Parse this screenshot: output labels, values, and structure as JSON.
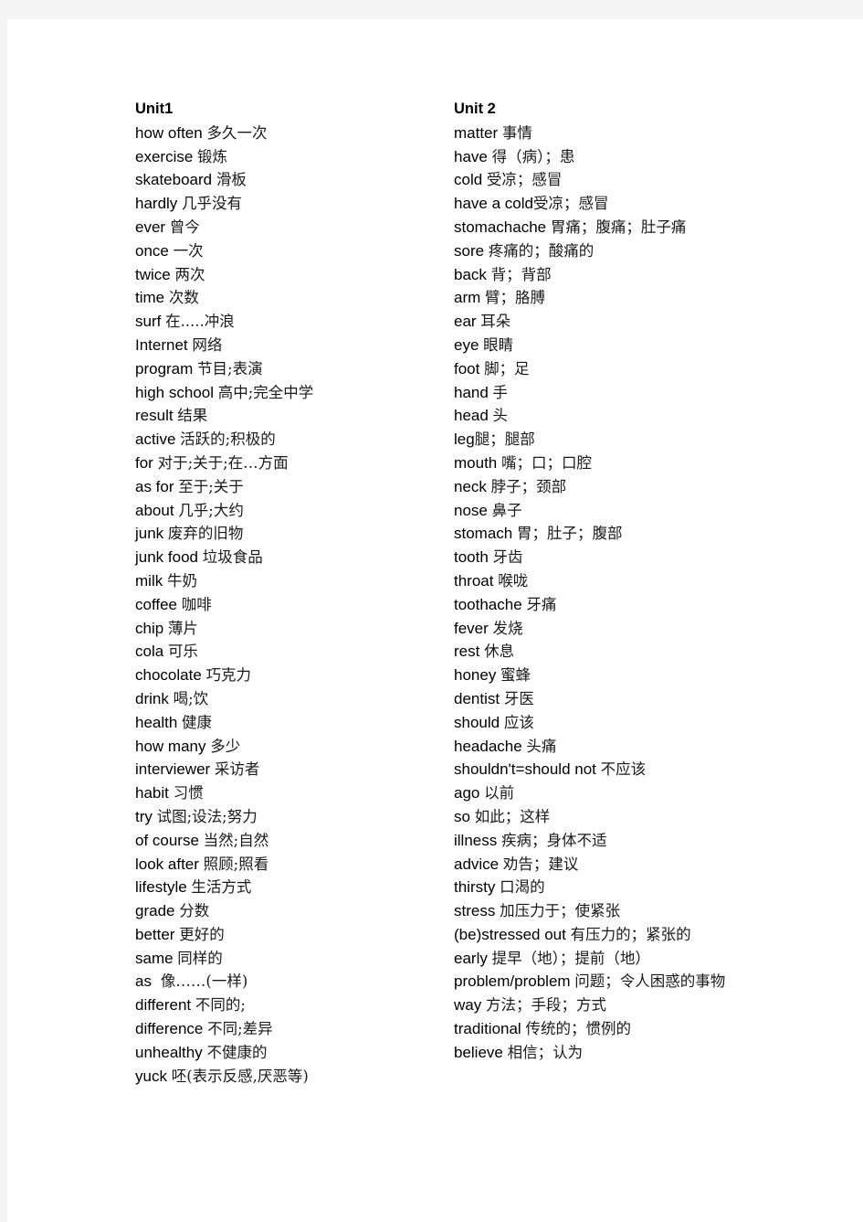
{
  "page": {
    "background_color": "#ffffff",
    "margin_color": "#f4f4f4",
    "text_color": "#000000"
  },
  "columns": [
    {
      "id": "unit1",
      "title": "Unit1",
      "entries": [
        {
          "en": "how often ",
          "cn": "多久一次"
        },
        {
          "en": "exercise ",
          "cn": "锻炼"
        },
        {
          "en": "skateboard ",
          "cn": "滑板"
        },
        {
          "en": "hardly ",
          "cn": "几乎没有"
        },
        {
          "en": "ever ",
          "cn": "曾今"
        },
        {
          "en": "once ",
          "cn": "一次"
        },
        {
          "en": "twice ",
          "cn": "两次"
        },
        {
          "en": "time ",
          "cn": "次数"
        },
        {
          "en": "surf ",
          "cn": "在.....冲浪"
        },
        {
          "en": "Internet ",
          "cn": "网络"
        },
        {
          "en": "program ",
          "cn": "节目;表演"
        },
        {
          "en": "high school ",
          "cn": "高中;完全中学"
        },
        {
          "en": "result ",
          "cn": "结果"
        },
        {
          "en": "active ",
          "cn": "活跃的;积极的"
        },
        {
          "en": "for ",
          "cn": "对于;关于;在…方面"
        },
        {
          "en": "as for ",
          "cn": "至于;关于"
        },
        {
          "en": "about ",
          "cn": "几乎;大约"
        },
        {
          "en": "junk ",
          "cn": "废弃的旧物"
        },
        {
          "en": "junk food ",
          "cn": "垃圾食品"
        },
        {
          "en": "milk ",
          "cn": "牛奶"
        },
        {
          "en": "coffee ",
          "cn": "咖啡"
        },
        {
          "en": "chip ",
          "cn": "薄片"
        },
        {
          "en": "cola ",
          "cn": "可乐"
        },
        {
          "en": "chocolate ",
          "cn": "巧克力"
        },
        {
          "en": "drink ",
          "cn": "喝;饮"
        },
        {
          "en": "health ",
          "cn": "健康"
        },
        {
          "en": "how many ",
          "cn": "多少"
        },
        {
          "en": "interviewer ",
          "cn": "采访者"
        },
        {
          "en": "habit ",
          "cn": "习惯"
        },
        {
          "en": "try ",
          "cn": "试图;设法;努力"
        },
        {
          "en": "of course ",
          "cn": "当然;自然"
        },
        {
          "en": "look after ",
          "cn": "照顾;照看"
        },
        {
          "en": "lifestyle ",
          "cn": "生活方式"
        },
        {
          "en": "grade ",
          "cn": "分数"
        },
        {
          "en": "better ",
          "cn": "更好的"
        },
        {
          "en": "same ",
          "cn": "同样的"
        },
        {
          "en": "as ",
          "cn": "  像……(一样)"
        },
        {
          "en": "different ",
          "cn": "不同的;"
        },
        {
          "en": "difference ",
          "cn": "不同;差异"
        },
        {
          "en": "unhealthy ",
          "cn": "不健康的"
        },
        {
          "en": "yuck ",
          "cn": "呸(表示反感,厌恶等)"
        }
      ]
    },
    {
      "id": "unit2",
      "title": "Unit 2",
      "entries": [
        {
          "en": "matter ",
          "cn": "事情"
        },
        {
          "en": "have ",
          "cn": "得（病）；患"
        },
        {
          "en": "cold ",
          "cn": "受凉；感冒"
        },
        {
          "en": "have a cold",
          "cn": "受凉；感冒"
        },
        {
          "en": "stomachache ",
          "cn": "胃痛；腹痛；肚子痛"
        },
        {
          "en": "sore ",
          "cn": "疼痛的；酸痛的"
        },
        {
          "en": "back ",
          "cn": "背；背部"
        },
        {
          "en": "arm ",
          "cn": "臂；胳膊"
        },
        {
          "en": "ear ",
          "cn": "耳朵"
        },
        {
          "en": "eye ",
          "cn": "眼睛"
        },
        {
          "en": "foot ",
          "cn": "脚；足"
        },
        {
          "en": "hand ",
          "cn": "手"
        },
        {
          "en": "head ",
          "cn": "头"
        },
        {
          "en": "leg",
          "cn": "腿；腿部"
        },
        {
          "en": "mouth ",
          "cn": "嘴；口；口腔"
        },
        {
          "en": "neck ",
          "cn": "脖子；颈部"
        },
        {
          "en": "nose ",
          "cn": "鼻子"
        },
        {
          "en": "stomach ",
          "cn": "胃；肚子；腹部"
        },
        {
          "en": "tooth ",
          "cn": "牙齿"
        },
        {
          "en": "throat ",
          "cn": "喉咙"
        },
        {
          "en": "toothache ",
          "cn": "牙痛"
        },
        {
          "en": "fever ",
          "cn": "发烧"
        },
        {
          "en": "rest ",
          "cn": "休息"
        },
        {
          "en": "honey ",
          "cn": "蜜蜂"
        },
        {
          "en": "dentist ",
          "cn": "牙医"
        },
        {
          "en": "should ",
          "cn": "应该"
        },
        {
          "en": "headache ",
          "cn": "头痛"
        },
        {
          "en": "shouldn't=should not ",
          "cn": "不应该"
        },
        {
          "en": "ago ",
          "cn": "以前"
        },
        {
          "en": "so ",
          "cn": "如此；这样"
        },
        {
          "en": "illness ",
          "cn": "疾病；身体不适"
        },
        {
          "en": "advice ",
          "cn": "劝告；建议"
        },
        {
          "en": "thirsty ",
          "cn": "口渴的"
        },
        {
          "en": "stress ",
          "cn": "加压力于；使紧张"
        },
        {
          "en": "(be)stressed out ",
          "cn": "有压力的；紧张的"
        },
        {
          "en": "early ",
          "cn": "提早（地）；提前（地）"
        },
        {
          "en": "problem/problem ",
          "cn": "问题；令人困惑的事物"
        },
        {
          "en": "way ",
          "cn": "方法；手段；方式"
        },
        {
          "en": "traditional ",
          "cn": "传统的；惯例的"
        },
        {
          "en": "believe ",
          "cn": "相信；认为"
        }
      ]
    }
  ]
}
